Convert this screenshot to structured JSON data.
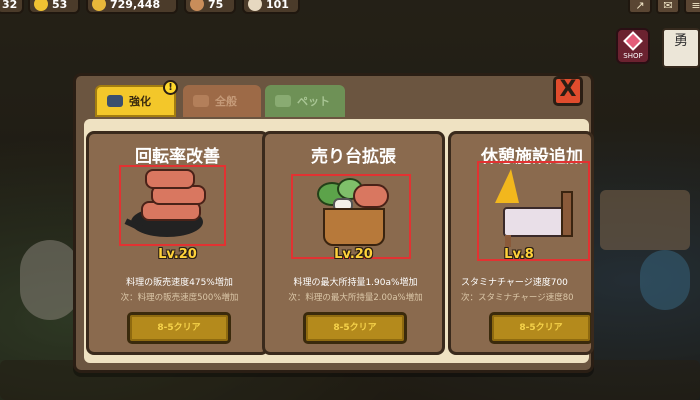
{
  "hud": {
    "stat1": "32",
    "stat2": "53",
    "coins": "729,448",
    "stat4": "75",
    "stat5": "101"
  },
  "side_card_text": "勇",
  "shop_label": "SHOP",
  "tabs": [
    {
      "label": "強化",
      "active": true
    },
    {
      "label": "全般",
      "active": false
    },
    {
      "label": "ペット",
      "active": false
    }
  ],
  "tab_alert": "!",
  "close_label": "X",
  "cards": [
    {
      "title": "回転率改善",
      "level": "Lv.20",
      "description": "料理の販売速度475%増加",
      "next": "次：料理の販売速度500%増加",
      "button": "8-5クリア"
    },
    {
      "title": "売り台拡張",
      "level": "Lv.20",
      "description": "料理の最大所持量1.90a%増加",
      "next": "次：料理の最大所持量2.00a%増加",
      "button": "8-5クリア"
    },
    {
      "title": "休憩施設追加",
      "level": "Lv.8",
      "description": "スタミナチャージ速度700",
      "next": "次：スタミナチャージ速度80",
      "button": "8-5クリア"
    }
  ],
  "colors": {
    "panel": "#6b5540",
    "card": "#8a6a4e",
    "tab_active": "#f3c72a",
    "highlight_box": "#e23232",
    "level_text": "#ffd23a",
    "close_button": "#e04c2d"
  }
}
